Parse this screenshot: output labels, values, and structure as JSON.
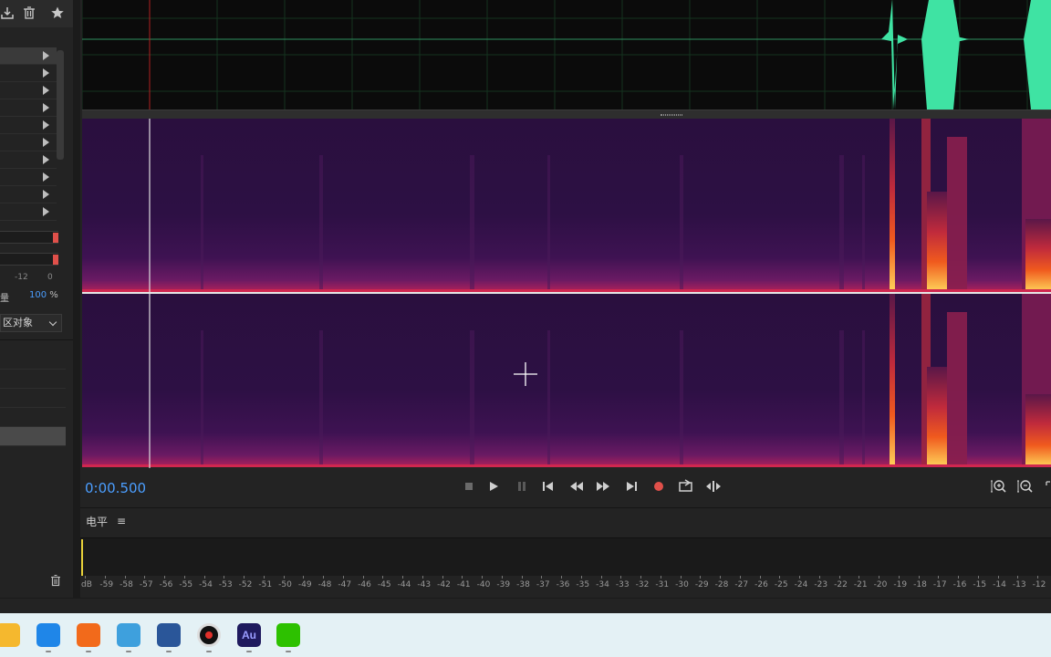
{
  "left_panel": {
    "fx_rack_count": 10,
    "mix_label": "量",
    "mix_value": "100",
    "mix_unit": "%",
    "meter_ticks": [
      "-12",
      "0"
    ],
    "dropdown_label": "区对象",
    "icons": [
      "import-icon",
      "trash-icon",
      "star-icon",
      "chevron-right-icon",
      "chevron-down-icon"
    ]
  },
  "transport": {
    "timecode": "0:00.500",
    "buttons": [
      "stop",
      "play",
      "pause",
      "go-to-start",
      "rewind",
      "fast-forward",
      "go-to-end",
      "record",
      "loop",
      "skip-selection",
      "zoom-in-amplitude",
      "zoom-out-amplitude"
    ]
  },
  "levels": {
    "title": "电平",
    "menu_icon": "≡",
    "scale_labels": [
      "dB",
      "-59",
      "-58",
      "-57",
      "-56",
      "-55",
      "-54",
      "-53",
      "-52",
      "-51",
      "-50",
      "-49",
      "-48",
      "-47",
      "-46",
      "-45",
      "-44",
      "-43",
      "-42",
      "-41",
      "-40",
      "-39",
      "-38",
      "-37",
      "-36",
      "-35",
      "-34",
      "-33",
      "-32",
      "-31",
      "-30",
      "-29",
      "-28",
      "-27",
      "-26",
      "-25",
      "-24",
      "-23",
      "-22",
      "-21",
      "-20",
      "-19",
      "-18",
      "-17",
      "-16",
      "-15",
      "-14",
      "-13",
      "-12"
    ]
  },
  "taskbar": {
    "apps": [
      {
        "name": "file-explorer",
        "color": "#f5b82e"
      },
      {
        "name": "kugou",
        "color": "#1f86e8"
      },
      {
        "name": "xiaomi-app",
        "color": "#f26a1b"
      },
      {
        "name": "notepad",
        "color": "#3ea0dd"
      },
      {
        "name": "word-doc",
        "color": "#2a5699"
      },
      {
        "name": "recorder",
        "color": "#111111"
      },
      {
        "name": "audition",
        "label": "Au",
        "color": "#1f1a5e"
      },
      {
        "name": "wechat",
        "color": "#2dc100"
      }
    ]
  },
  "colors": {
    "accent_blue": "#4b9eff",
    "record_red": "#e0504a",
    "waveform_green": "#3fe3a3",
    "playhead": "#e0e0e0"
  }
}
